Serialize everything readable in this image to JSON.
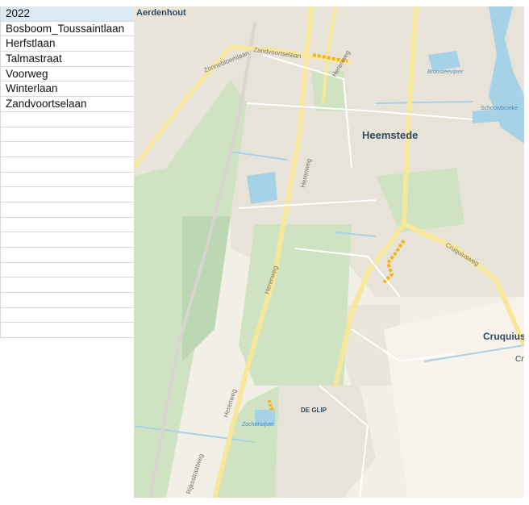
{
  "sheet": {
    "header": "2022",
    "rows": [
      "Bosboom_Toussaintlaan",
      "Herfstlaan",
      "Talmastraat",
      "Voorweg",
      "Winterlaan",
      "Zandvoortselaan",
      "",
      "",
      "",
      "",
      "",
      "",
      "",
      "",
      "",
      "",
      "",
      "",
      "",
      "",
      ""
    ]
  },
  "map": {
    "places": {
      "aerdenhout": "Aerdenhout",
      "heemstede": "Heemstede",
      "cruquius": "Cruquius",
      "cruquius_cut": "Cru",
      "de_glip": "DE GLIP"
    },
    "streets": {
      "zonnebloemlaan": "Zonnebloemlaan",
      "zandvoortselaan": "Zandvoortselaan",
      "herenweg": "Herenweg",
      "cruquiusweg": "Cruquiusweg",
      "rijksstraatweg": "Rijksstraatweg"
    },
    "water": {
      "bronsteevijver": "Bronsteevijver",
      "schouwbroeker": "Schouwbroeke",
      "zocherivijver": "Zocherivijver"
    },
    "colors": {
      "land": "#f2efe6",
      "built": "#e7e3d9",
      "green": "#cfe3c3",
      "green_dark": "#bcd8b2",
      "water": "#a6d2e7",
      "road_major": "#f6e79a",
      "highlight": "#f3b51d"
    }
  }
}
